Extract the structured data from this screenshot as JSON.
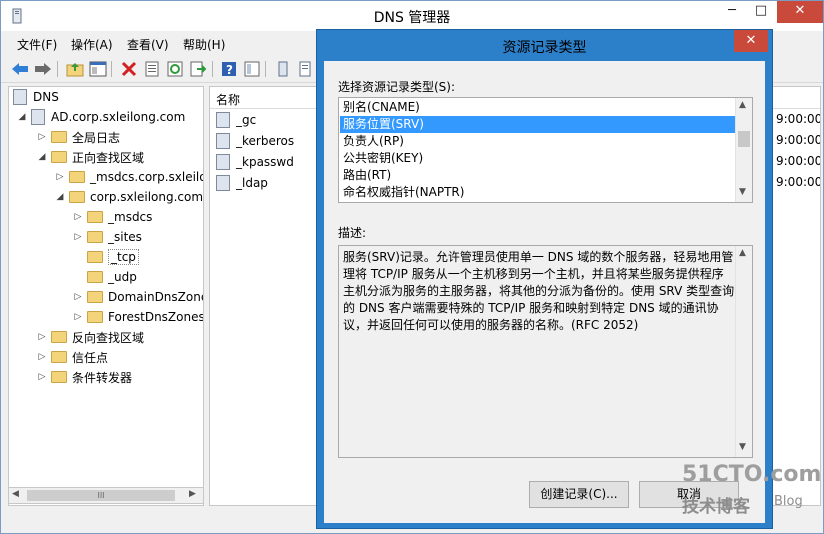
{
  "window": {
    "title": "DNS 管理器",
    "min": "─",
    "max": "□",
    "close": "✕"
  },
  "menu": [
    "文件(F)",
    "操作(A)",
    "查看(V)",
    "帮助(H)"
  ],
  "toolbar_icons": [
    "back-icon",
    "forward-icon",
    "up-folder-icon",
    "show-hide-tree-icon",
    "delete-icon",
    "properties-icon",
    "refresh-icon",
    "export-icon",
    "help-icon",
    "view-icon",
    "server-icon",
    "list-icon"
  ],
  "tree": {
    "items": [
      {
        "label": "DNS"
      },
      {
        "label": "AD.corp.sxleilong.com"
      },
      {
        "label": "全局日志"
      },
      {
        "label": "正向查找区域"
      },
      {
        "label": "_msdcs.corp.sxleilo"
      },
      {
        "label": "corp.sxleilong.com"
      },
      {
        "label": "_msdcs"
      },
      {
        "label": "_sites"
      },
      {
        "label": "_tcp"
      },
      {
        "label": "_udp"
      },
      {
        "label": "DomainDnsZone"
      },
      {
        "label": "ForestDnsZones"
      },
      {
        "label": "反向查找区域"
      },
      {
        "label": "信任点"
      },
      {
        "label": "条件转发器"
      }
    ],
    "scroll_thumb": "III"
  },
  "list": {
    "column_name": "名称",
    "rows": [
      "_gc",
      "_kerberos",
      "_kpasswd",
      "_ldap"
    ],
    "times": [
      "9:00:00",
      "9:00:00",
      "9:00:00",
      "9:00:00"
    ]
  },
  "dialog": {
    "title": "资源记录类型",
    "close": "✕",
    "select_label": "选择资源记录类型(S):",
    "record_types": [
      "别名(CNAME)",
      "服务位置(SRV)",
      "负责人(RP)",
      "公共密钥(KEY)",
      "路由(RT)",
      "命名权威指针(NAPTR)"
    ],
    "selected_index": 1,
    "desc_label": "描述:",
    "description": "服务(SRV)记录。允许管理员使用单一 DNS 域的数个服务器，轻易地用管理将 TCP/IP 服务从一个主机移到另一个主机，并且将某些服务提供程序主机分派为服务的主服务器，将其他的分派为备份的。使用 SRV 类型查询的 DNS 客户端需要特殊的 TCP/IP 服务和映射到特定 DNS 域的通讯协议，并返回任何可以使用的服务器的名称。(RFC 2052)",
    "create_button": "创建记录(C)...",
    "cancel_button": "取消"
  },
  "watermark": {
    "line1": "51CTO.com",
    "line2": "技术博客",
    "line3": "Blog"
  }
}
